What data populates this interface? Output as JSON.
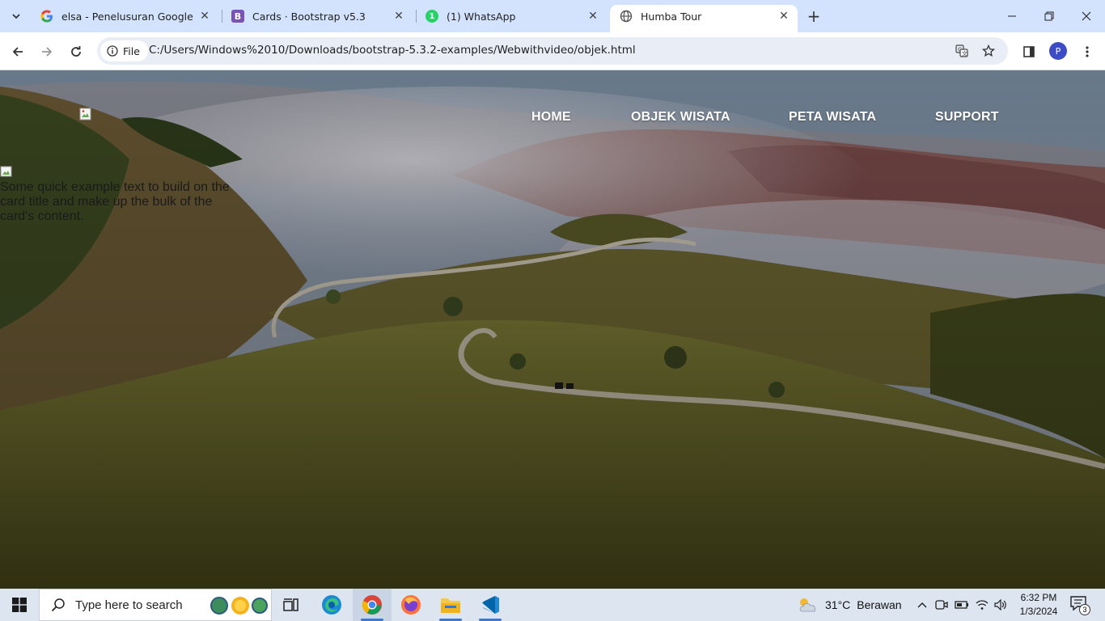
{
  "browser": {
    "tabs": [
      {
        "title": "elsa - Penelusuran Google",
        "favicon": "google-icon"
      },
      {
        "title": "Cards · Bootstrap v5.3",
        "favicon": "bootstrap-icon",
        "favicon_letter": "B"
      },
      {
        "title": "(1) WhatsApp",
        "favicon": "whatsapp-icon",
        "favicon_badge": "1"
      },
      {
        "title": "Humba Tour",
        "favicon": "globe-icon",
        "active": true
      }
    ],
    "address_chip": "File",
    "url": "C:/Users/Windows%2010/Downloads/bootstrap-5.3.2-examples/Webwithvideo/objek.html",
    "profile_initial": "P"
  },
  "page": {
    "nav": {
      "items": [
        "HOME",
        "OBJEK WISATA",
        "PETA WISATA",
        "SUPPORT"
      ]
    },
    "card": {
      "text": "Some quick example text to build on the card title and make up the bulk of the card's content."
    }
  },
  "taskbar": {
    "search_placeholder": "Type here to search",
    "weather_temp": "31°C",
    "weather_text": "Berawan",
    "time": "6:32 PM",
    "date": "1/3/2024",
    "notification_count": "3"
  },
  "colors": {
    "tabstrip": "#d3e3fd",
    "accent": "#3b78d8",
    "bootstrap": "#7952b3",
    "whatsapp": "#25d366"
  }
}
